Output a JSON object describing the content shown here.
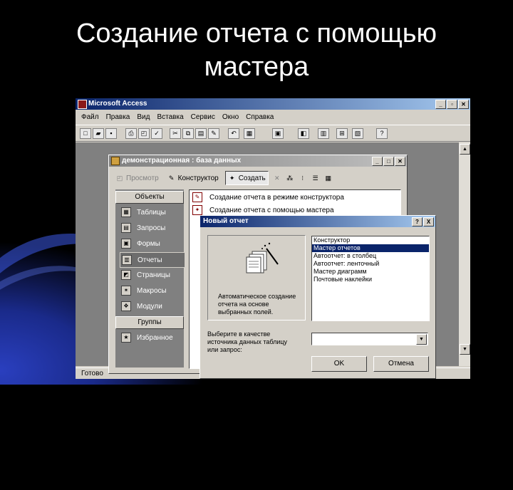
{
  "slide": {
    "title_line1": "Создание отчета с помощью",
    "title_line2": "мастера"
  },
  "app": {
    "title": "Microsoft Access",
    "menu": [
      "Файл",
      "Правка",
      "Вид",
      "Вставка",
      "Сервис",
      "Окно",
      "Справка"
    ],
    "status": "Готово"
  },
  "db_window": {
    "title": "демонстрационная : база данных",
    "toolbar": {
      "preview": "Просмотр",
      "design": "Конструктор",
      "create": "Создать"
    },
    "objects_header": "Объекты",
    "objects": [
      "Таблицы",
      "Запросы",
      "Формы",
      "Отчеты",
      "Страницы",
      "Макросы",
      "Модули"
    ],
    "groups_header": "Группы",
    "groups": [
      "Избранное"
    ],
    "items": [
      "Создание отчета в режиме конструктора",
      "Создание отчета с помощью мастера"
    ]
  },
  "dialog": {
    "title": "Новый отчет",
    "help_btn": "?",
    "close_btn": "X",
    "description": "Автоматическое создание отчета на основе выбранных полей.",
    "options": [
      "Конструктор",
      "Мастер отчетов",
      "Автоотчет: в столбец",
      "Автоотчет: ленточный",
      "Мастер диаграмм",
      "Почтовые наклейки"
    ],
    "selected_index": 1,
    "source_label": "Выберите в качестве источника данных таблицу или запрос:",
    "source_value": "",
    "ok": "OK",
    "cancel": "Отмена"
  }
}
